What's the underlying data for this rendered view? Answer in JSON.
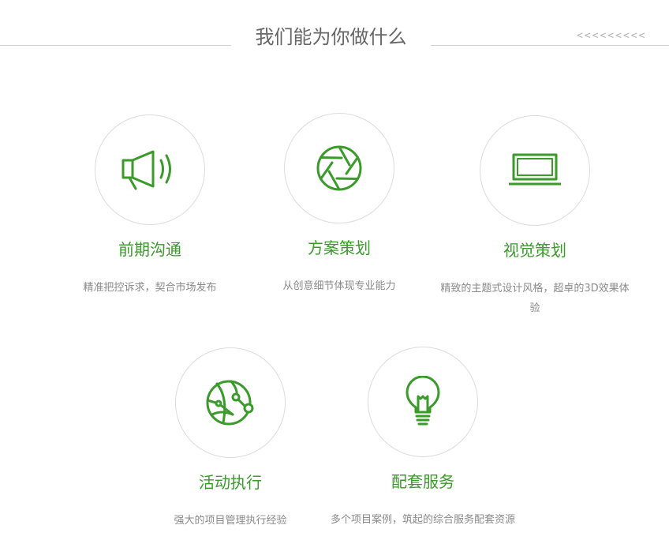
{
  "section": {
    "title": "我们能为你做什么",
    "decoration": "<<<<<<<<<"
  },
  "colors": {
    "accent": "#3a9a2a",
    "text_muted": "#8a8a8a",
    "title_gray": "#666666",
    "rule": "#d2d2d2"
  },
  "services": [
    {
      "icon": "megaphone-icon",
      "title": "前期沟通",
      "desc": "精准把控诉求，契合市场发布"
    },
    {
      "icon": "aperture-icon",
      "title": "方案策划",
      "desc": "从创意细节体现专业能力"
    },
    {
      "icon": "laptop-icon",
      "title": "视觉策划",
      "desc": "精致的主题式设计风格，超卓的3D效果体验"
    },
    {
      "icon": "network-globe-icon",
      "title": "活动执行",
      "desc": "强大的项目管理执行经验"
    },
    {
      "icon": "light-bulb-icon",
      "title": "配套服务",
      "desc": "多个项目案例，筑起的综合服务配套资源"
    }
  ]
}
